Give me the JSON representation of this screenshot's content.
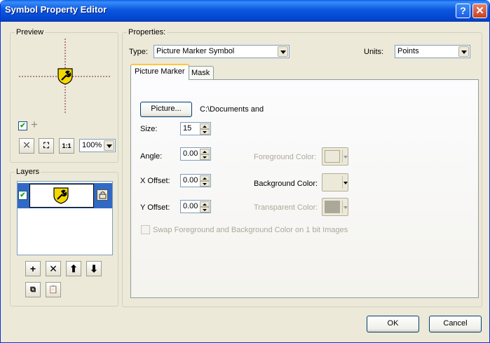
{
  "window": {
    "title": "Symbol Property Editor",
    "help_label": "?",
    "close_label": "✕"
  },
  "preview": {
    "group_label": "Preview",
    "zoom_value": "100%",
    "checkbox_checked": true
  },
  "layers": {
    "group_label": "Layers",
    "items": [
      {
        "checked": true,
        "selected": true,
        "locked": true
      }
    ]
  },
  "properties": {
    "group_label": "Properties:",
    "type_label": "Type:",
    "type_value": "Picture Marker Symbol",
    "units_label": "Units:",
    "units_value": "Points",
    "tabs": [
      {
        "label": "Picture Marker",
        "active": true
      },
      {
        "label": "Mask",
        "active": false
      }
    ],
    "picture_button": "Picture...",
    "picture_path": "C:\\Documents and",
    "size_label": "Size:",
    "size_value": "15",
    "angle_label": "Angle:",
    "angle_value": "0.00",
    "xoffset_label": "X Offset:",
    "xoffset_value": "0.00",
    "yoffset_label": "Y Offset:",
    "yoffset_value": "0.00",
    "foreground_label": "Foreground Color:",
    "background_label": "Background Color:",
    "transparent_label": "Transparent Color:",
    "swap_label": "Swap Foreground and Background Color on 1 bit Images",
    "swap_checked": false
  },
  "footer": {
    "ok_label": "OK",
    "cancel_label": "Cancel"
  },
  "colors": {
    "titlebar": "#0A58E0",
    "dialog_bg": "#ECE9D8",
    "selection": "#316AC5",
    "symbol_yellow": "#F5D800"
  },
  "icons": {
    "preview_toolbar": [
      "zoom-in-icon",
      "zoom-out-icon",
      "actual-size-icon"
    ],
    "layer_tools": [
      "add-layer-icon",
      "delete-layer-icon",
      "move-up-icon",
      "move-down-icon"
    ],
    "clipboard_tools": [
      "copy-icon",
      "paste-icon"
    ],
    "symbol": "wrench-shield-icon",
    "lock": "lock-icon"
  }
}
